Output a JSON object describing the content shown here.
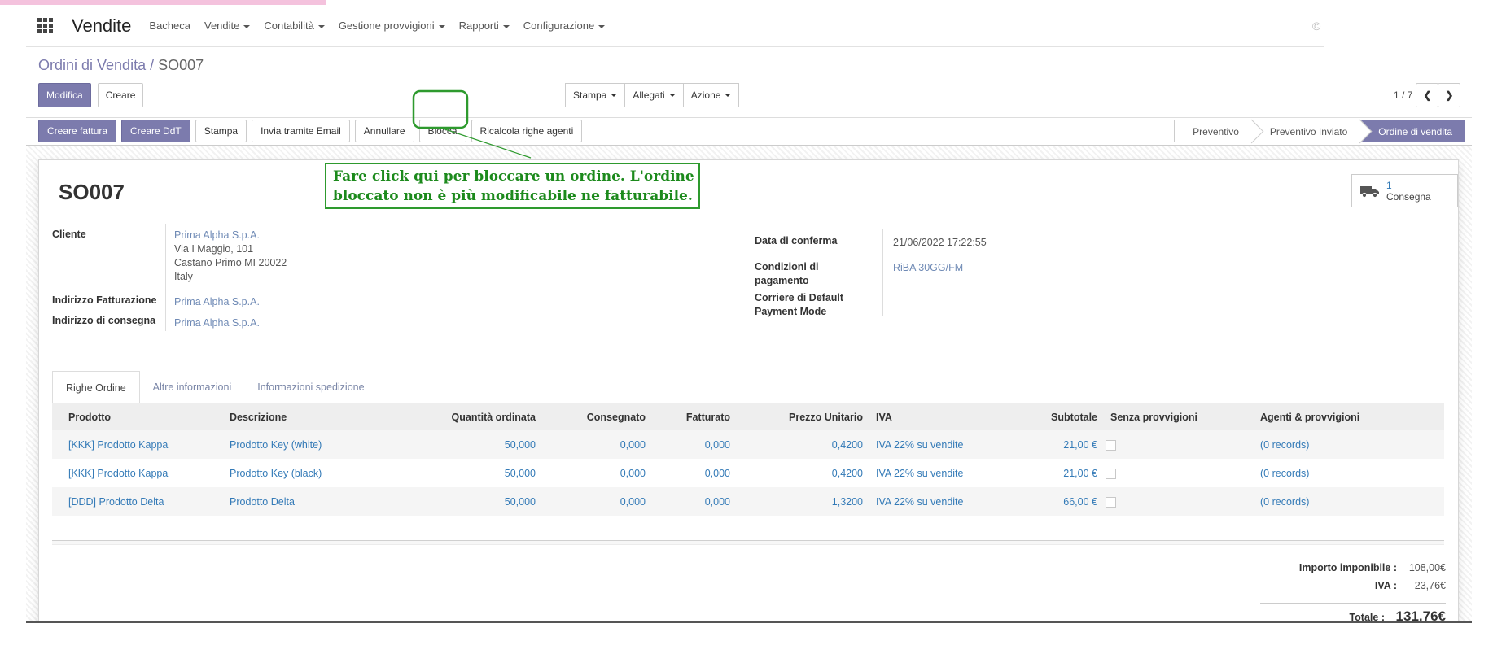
{
  "navbar": {
    "brand": "Vendite",
    "menu": [
      {
        "label": "Bacheca",
        "dropdown": false
      },
      {
        "label": "Vendite",
        "dropdown": true
      },
      {
        "label": "Contabilità",
        "dropdown": true
      },
      {
        "label": "Gestione provvigioni",
        "dropdown": true
      },
      {
        "label": "Rapporti",
        "dropdown": true
      },
      {
        "label": "Configurazione",
        "dropdown": true
      }
    ],
    "right_glyph": "©"
  },
  "breadcrumb": {
    "parent": "Ordini di Vendita",
    "separator": " / ",
    "current": "SO007"
  },
  "control_panel": {
    "edit_label": "Modifica",
    "create_label": "Creare",
    "print_label": "Stampa",
    "attachments_label": "Allegati",
    "action_label": "Azione",
    "pager_value": "1 / 7"
  },
  "statusbar": {
    "buttons": [
      {
        "label": "Creare fattura",
        "primary": true
      },
      {
        "label": "Creare DdT",
        "primary": true
      },
      {
        "label": "Stampa",
        "primary": false
      },
      {
        "label": "Invia tramite Email",
        "primary": false
      },
      {
        "label": "Annullare",
        "primary": false
      },
      {
        "label": "Blocca",
        "primary": false
      },
      {
        "label": "Ricalcola righe agenti",
        "primary": false
      }
    ],
    "states": [
      {
        "label": "Preventivo",
        "active": false
      },
      {
        "label": "Preventivo Inviato",
        "active": false
      },
      {
        "label": "Ordine di vendita",
        "active": true
      }
    ]
  },
  "annotation": {
    "line1": "Fare click qui per bloccare un ordine. L'ordine",
    "line2": "bloccato non è più modificabile ne fatturabile.",
    "color": "#2e9a2e"
  },
  "form": {
    "title": "SO007",
    "smart_button": {
      "count": "1",
      "label": "Consegna",
      "icon": "truck-icon"
    },
    "cliente_label": "Cliente",
    "cliente_name": "Prima Alpha S.p.A.",
    "cliente_address": [
      "Via I Maggio, 101",
      "Castano Primo MI 20022",
      "Italy"
    ],
    "fatturazione_label": "Indirizzo Fatturazione",
    "fatturazione_value": "Prima Alpha S.p.A.",
    "consegna_label": "Indirizzo di consegna",
    "consegna_value": "Prima Alpha S.p.A.",
    "data_conferma_label": "Data di conferma",
    "data_conferma_value": "21/06/2022 17:22:55",
    "condizioni_label_1": "Condizioni di",
    "condizioni_label_2": "pagamento",
    "condizioni_value": "RiBA 30GG/FM",
    "corriere_label_1": "Corriere di Default",
    "corriere_label_2": "Payment Mode"
  },
  "tabs": [
    "Righe Ordine",
    "Altre informazioni",
    "Informazioni spedizione"
  ],
  "order_lines": {
    "headers": [
      "Prodotto",
      "Descrizione",
      "Quantità ordinata",
      "Consegnato",
      "Fatturato",
      "Prezzo Unitario",
      "IVA",
      "Subtotale",
      "Senza provvigioni",
      "Agenti & provvigioni"
    ],
    "rows": [
      [
        "[KKK] Prodotto Kappa",
        "Prodotto Key (white)",
        "50,000",
        "0,000",
        "0,000",
        "0,4200",
        "IVA 22% su vendite",
        "21,00 €",
        "",
        "(0 records)"
      ],
      [
        "[KKK] Prodotto Kappa",
        "Prodotto Key (black)",
        "50,000",
        "0,000",
        "0,000",
        "0,4200",
        "IVA 22% su vendite",
        "21,00 €",
        "",
        "(0 records)"
      ],
      [
        "[DDD] Prodotto Delta",
        "Prodotto Delta",
        "50,000",
        "0,000",
        "0,000",
        "1,3200",
        "IVA 22% su vendite",
        "66,00 €",
        "",
        "(0 records)"
      ]
    ]
  },
  "totals": {
    "imponibile_label": "Importo imponibile :",
    "imponibile_value": "108,00€",
    "iva_label": "IVA :",
    "iva_value": "23,76€",
    "totale_label": "Totale :",
    "totale_value": "131,76€"
  },
  "colors": {
    "brand": "#7c7bad",
    "link": "#337ab7",
    "annotation": "#2e9a2e"
  }
}
